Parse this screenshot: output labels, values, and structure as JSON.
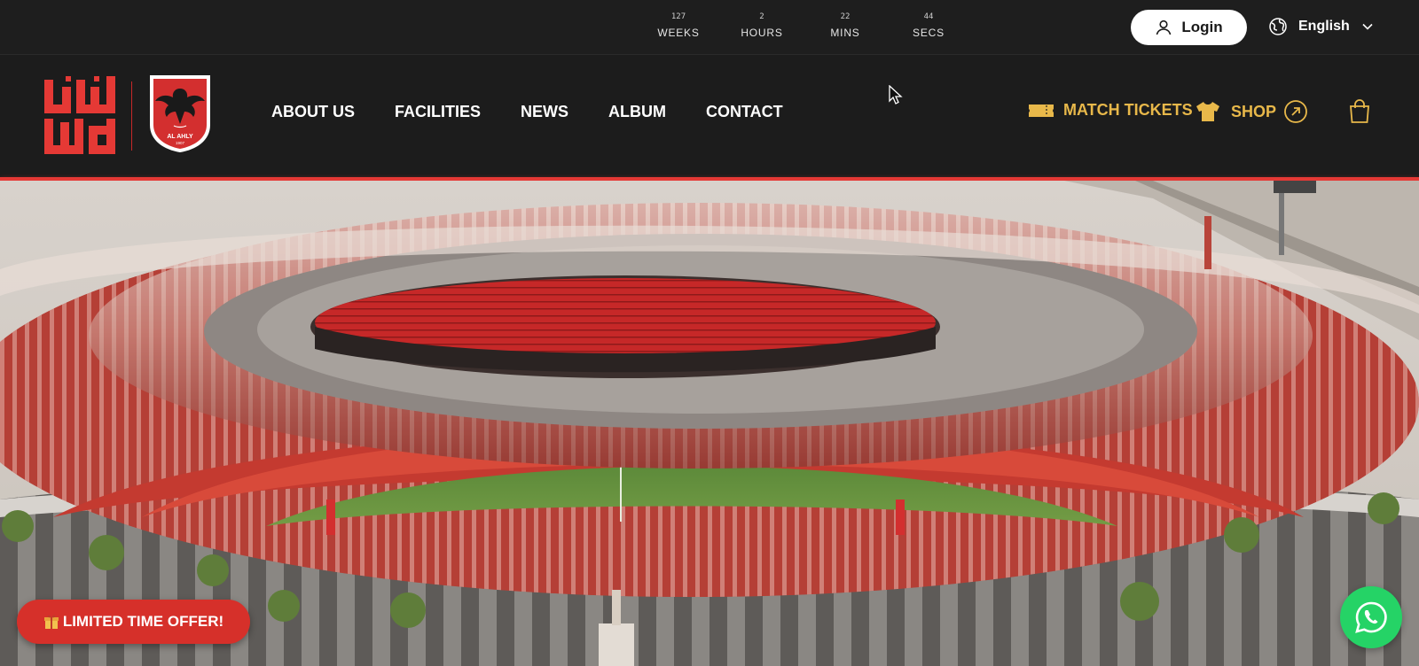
{
  "countdown": {
    "weeks": {
      "value": "127",
      "label": "WEEKS"
    },
    "hours": {
      "value": "2",
      "label": "HOURS"
    },
    "mins": {
      "value": "22",
      "label": "MINS"
    },
    "secs": {
      "value": "44",
      "label": "SECS"
    }
  },
  "header": {
    "login_label": "Login",
    "language": "English"
  },
  "nav": {
    "items": [
      "ABOUT US",
      "FACILITIES",
      "NEWS",
      "ALBUM",
      "CONTACT"
    ]
  },
  "actions": {
    "tickets_label": "MATCH TICKETS",
    "shop_label": "SHOP"
  },
  "brand": {
    "crest_text": "AL AHLY",
    "crest_year": "1907",
    "red": "#e53935",
    "gold": "#e8b84a"
  },
  "promo": {
    "offer_label": "LIMITED TIME OFFER!"
  },
  "icons": {
    "user": "user-icon",
    "globe": "globe-icon",
    "chevron": "chevron-down-icon",
    "ticket": "ticket-icon",
    "shirt": "shirt-icon",
    "arrow": "external-arrow-icon",
    "cart": "shopping-bag-icon",
    "gift": "gift-icon",
    "whatsapp": "whatsapp-icon"
  }
}
